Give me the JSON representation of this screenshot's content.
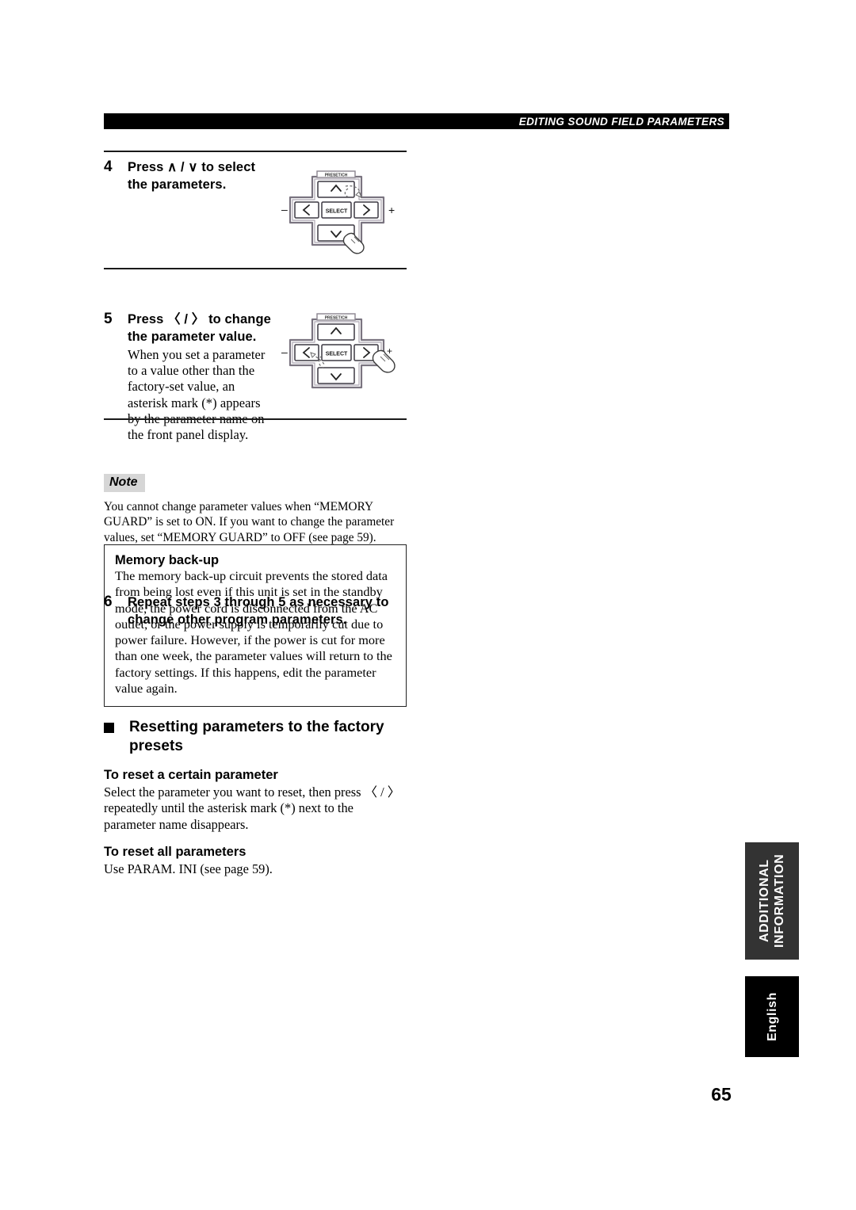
{
  "header": {
    "title": "EDITING SOUND FIELD PARAMETERS"
  },
  "steps": [
    {
      "number": "4",
      "heading_line1": "Press ∧ / ∨ to select",
      "heading_line2": "the parameters.",
      "body": ""
    },
    {
      "number": "5",
      "heading_line1": "Press 〈 / 〉 to change",
      "heading_line2": "the parameter value.",
      "body": "When you set a parameter to a value other than the factory-set value, an asterisk mark (*) appears by the parameter name on the front panel display."
    },
    {
      "number": "6",
      "heading_line1": "Repeat steps 3 through 5 as necessary to",
      "heading_line2": "change other program parameters.",
      "body": ""
    }
  ],
  "note": {
    "badge": "Note",
    "text": "You cannot change parameter values when “MEMORY GUARD” is set to ON. If you want to change the parameter values, set “MEMORY GUARD” to OFF (see page 59)."
  },
  "memory_panel": {
    "title": "Memory back-up",
    "text": "The memory back-up circuit prevents the stored data from being lost even if this unit is set in the standby mode, the power cord is disconnected from the AC outlet, or the power supply is temporarily cut due to power failure. However, if the power is cut for more than one week, the parameter values will return to the factory settings. If this happens, edit the parameter value again."
  },
  "reset_section": {
    "heading": "Resetting parameters to the factory presets",
    "sub1_title": "To reset a certain parameter",
    "sub1_text": "Select the parameter you want to reset, then press 〈 / 〉 repeatedly until the asterisk mark (*) next to the parameter name disappears.",
    "sub2_title": "To reset all parameters",
    "sub2_text": "Use PARAM. INI (see page 59)."
  },
  "remote": {
    "preset_label": "PRESET/CH",
    "select_label": "SELECT",
    "up_label": "∧",
    "down_label": "∨",
    "left_label": "‹",
    "right_label": "›",
    "minus_label": "–",
    "plus_label": "+"
  },
  "side_tabs": {
    "additional": "ADDITIONAL INFORMATION",
    "language": "English"
  },
  "page_number": "65",
  "colors": {
    "header_bar": "#000000",
    "note_badge": "#d6d6d6",
    "tab_additional": "#333333",
    "tab_language": "#000000"
  }
}
